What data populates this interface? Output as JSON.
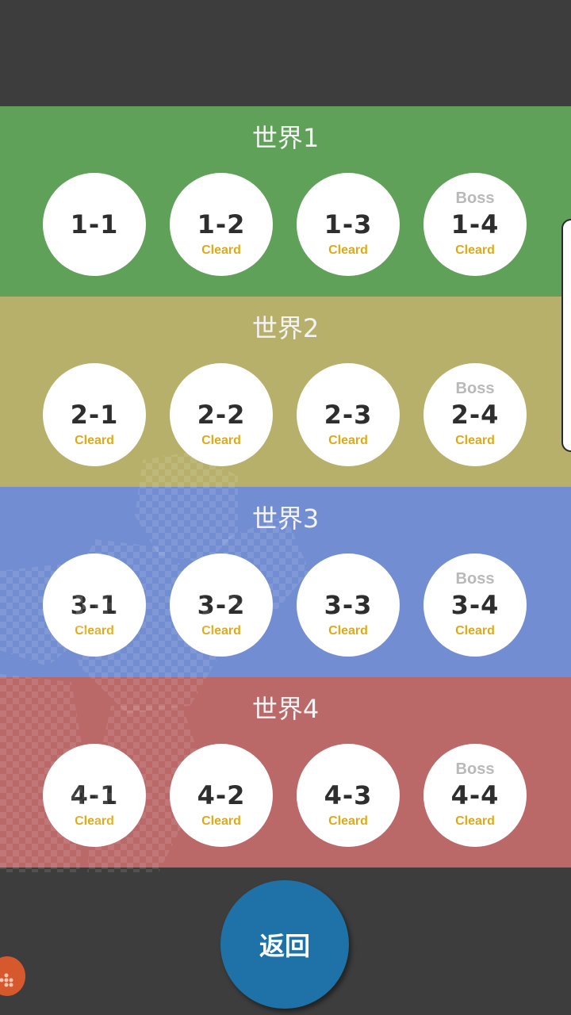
{
  "worlds": [
    {
      "title": "世界1",
      "color": "#60a159",
      "stages": [
        {
          "label": "1-1",
          "boss": "",
          "status": ""
        },
        {
          "label": "1-2",
          "boss": "",
          "status": "Cleard"
        },
        {
          "label": "1-3",
          "boss": "",
          "status": "Cleard"
        },
        {
          "label": "1-4",
          "boss": "Boss",
          "status": "Cleard"
        }
      ]
    },
    {
      "title": "世界2",
      "color": "#b7b06b",
      "stages": [
        {
          "label": "2-1",
          "boss": "",
          "status": "Cleard"
        },
        {
          "label": "2-2",
          "boss": "",
          "status": "Cleard"
        },
        {
          "label": "2-3",
          "boss": "",
          "status": "Cleard"
        },
        {
          "label": "2-4",
          "boss": "Boss",
          "status": "Cleard"
        }
      ]
    },
    {
      "title": "世界3",
      "color": "#728dd1",
      "stages": [
        {
          "label": "3-1",
          "boss": "",
          "status": "Cleard"
        },
        {
          "label": "3-2",
          "boss": "",
          "status": "Cleard"
        },
        {
          "label": "3-3",
          "boss": "",
          "status": "Cleard"
        },
        {
          "label": "3-4",
          "boss": "Boss",
          "status": "Cleard"
        }
      ]
    },
    {
      "title": "世界4",
      "color": "#ba6868",
      "stages": [
        {
          "label": "4-1",
          "boss": "",
          "status": "Cleard"
        },
        {
          "label": "4-2",
          "boss": "",
          "status": "Cleard"
        },
        {
          "label": "4-3",
          "boss": "",
          "status": "Cleard"
        },
        {
          "label": "4-4",
          "boss": "Boss",
          "status": "Cleard"
        }
      ]
    }
  ],
  "back_label": "返回",
  "colors": {
    "background": "#3d3d3d",
    "back_button": "#1f72a8",
    "cleared_text": "#e0aa12",
    "boss_text": "#b9b9b9"
  }
}
